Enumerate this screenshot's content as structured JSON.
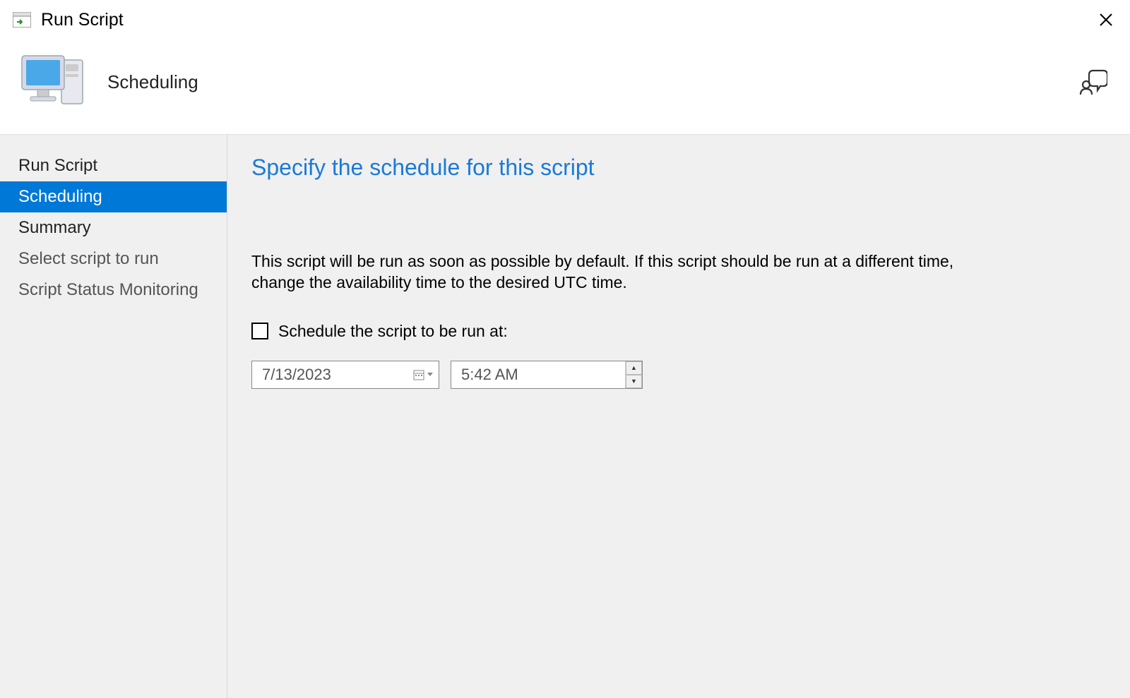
{
  "window": {
    "title": "Run Script"
  },
  "header": {
    "title": "Scheduling"
  },
  "sidebar": {
    "items": [
      {
        "label": "Run Script",
        "selected": false,
        "secondary": false
      },
      {
        "label": "Scheduling",
        "selected": true,
        "secondary": false
      },
      {
        "label": "Summary",
        "selected": false,
        "secondary": false
      },
      {
        "label": "Select script to run",
        "selected": false,
        "secondary": true
      },
      {
        "label": "Script Status Monitoring",
        "selected": false,
        "secondary": true
      }
    ]
  },
  "main": {
    "heading": "Specify the schedule for this script",
    "description": "This script will be run as soon as possible by default. If this script should be run at a different time, change the availability time to the desired UTC time.",
    "checkbox_label": "Schedule the script to be run at:",
    "date_value": "7/13/2023",
    "time_value": "5:42 AM"
  }
}
